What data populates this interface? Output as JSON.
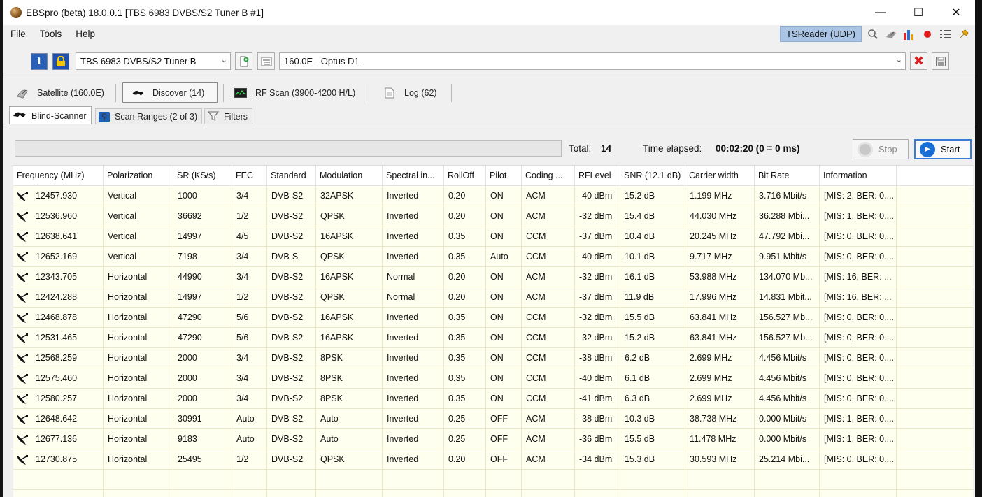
{
  "window": {
    "title": "EBSpro (beta) 18.0.0.1 [TBS 6983 DVBS/S2 Tuner B #1]",
    "controls": {
      "minimize": "—",
      "maximize": "☐",
      "close": "✕"
    }
  },
  "menu": {
    "items": [
      "File",
      "Tools",
      "Help"
    ],
    "tsreader": "TSReader (UDP)",
    "toolbar_icons": [
      "search-icon",
      "satellite-dish-icon",
      "bar-chart-icon",
      "record-icon",
      "list-icon",
      "pin-icon"
    ]
  },
  "device": {
    "tuner": "TBS 6983 DVBS/S2 Tuner B",
    "satellite": "160.0E - Optus D1"
  },
  "tabs": [
    {
      "label": "Satellite (160.0E)",
      "icon": "satellite-icon"
    },
    {
      "label": "Discover (14)",
      "icon": "discover-icon"
    },
    {
      "label": "RF Scan (3900-4200 H/L)",
      "icon": "spectrum-icon"
    },
    {
      "label": "Log (62)",
      "icon": "log-icon"
    }
  ],
  "subtabs": [
    {
      "label": "Blind-Scanner"
    },
    {
      "label": "Scan Ranges (2 of 3)"
    },
    {
      "label": "Filters"
    }
  ],
  "scanner": {
    "progress": 0,
    "total_label": "Total:",
    "total": "14",
    "elapsed_label": "Time elapsed:",
    "elapsed": "00:02:20 (0 = 0 ms)",
    "stop": "Stop",
    "start": "Start"
  },
  "table": {
    "headers": [
      "Frequency (MHz)",
      "Polarization",
      "SR (KS/s)",
      "FEC",
      "Standard",
      "Modulation",
      "Spectral in...",
      "RollOff",
      "Pilot",
      "Coding ...",
      "RFLevel",
      "SNR (12.1 dB)",
      "Carrier width",
      "Bit Rate",
      "Information"
    ],
    "rows": [
      [
        "12457.930",
        "Vertical",
        "1000",
        "3/4",
        "DVB-S2",
        "32APSK",
        "Inverted",
        "0.20",
        "ON",
        "ACM",
        "-40 dBm",
        "15.2 dB",
        "1.199 MHz",
        "3.716 Mbit/s",
        "[MIS: 2, BER: 0...."
      ],
      [
        "12536.960",
        "Vertical",
        "36692",
        "1/2",
        "DVB-S2",
        "QPSK",
        "Inverted",
        "0.20",
        "ON",
        "ACM",
        "-32 dBm",
        "15.4 dB",
        "44.030 MHz",
        "36.288 Mbi...",
        "[MIS: 1, BER: 0...."
      ],
      [
        "12638.641",
        "Vertical",
        "14997",
        "4/5",
        "DVB-S2",
        "16APSK",
        "Inverted",
        "0.35",
        "ON",
        "CCM",
        "-37 dBm",
        "10.4 dB",
        "20.245 MHz",
        "47.792 Mbi...",
        "[MIS: 0, BER: 0...."
      ],
      [
        "12652.169",
        "Vertical",
        "7198",
        "3/4",
        "DVB-S",
        "QPSK",
        "Inverted",
        "0.35",
        "Auto",
        "CCM",
        "-40 dBm",
        "10.1 dB",
        "9.717 MHz",
        "9.951 Mbit/s",
        "[MIS: 0, BER: 0...."
      ],
      [
        "12343.705",
        "Horizontal",
        "44990",
        "3/4",
        "DVB-S2",
        "16APSK",
        "Normal",
        "0.20",
        "ON",
        "ACM",
        "-32 dBm",
        "16.1 dB",
        "53.988 MHz",
        "134.070 Mb...",
        "[MIS: 16, BER: ..."
      ],
      [
        "12424.288",
        "Horizontal",
        "14997",
        "1/2",
        "DVB-S2",
        "QPSK",
        "Normal",
        "0.20",
        "ON",
        "ACM",
        "-37 dBm",
        "11.9 dB",
        "17.996 MHz",
        "14.831 Mbit...",
        "[MIS: 16, BER: ..."
      ],
      [
        "12468.878",
        "Horizontal",
        "47290",
        "5/6",
        "DVB-S2",
        "16APSK",
        "Inverted",
        "0.35",
        "ON",
        "CCM",
        "-32 dBm",
        "15.5 dB",
        "63.841 MHz",
        "156.527 Mb...",
        "[MIS: 0, BER: 0...."
      ],
      [
        "12531.465",
        "Horizontal",
        "47290",
        "5/6",
        "DVB-S2",
        "16APSK",
        "Inverted",
        "0.35",
        "ON",
        "CCM",
        "-32 dBm",
        "15.2 dB",
        "63.841 MHz",
        "156.527 Mb...",
        "[MIS: 0, BER: 0...."
      ],
      [
        "12568.259",
        "Horizontal",
        "2000",
        "3/4",
        "DVB-S2",
        "8PSK",
        "Inverted",
        "0.35",
        "ON",
        "CCM",
        "-38 dBm",
        "6.2 dB",
        "2.699 MHz",
        "4.456 Mbit/s",
        "[MIS: 0, BER: 0...."
      ],
      [
        "12575.460",
        "Horizontal",
        "2000",
        "3/4",
        "DVB-S2",
        "8PSK",
        "Inverted",
        "0.35",
        "ON",
        "CCM",
        "-40 dBm",
        "6.1 dB",
        "2.699 MHz",
        "4.456 Mbit/s",
        "[MIS: 0, BER: 0...."
      ],
      [
        "12580.257",
        "Horizontal",
        "2000",
        "3/4",
        "DVB-S2",
        "8PSK",
        "Inverted",
        "0.35",
        "ON",
        "CCM",
        "-41 dBm",
        "6.3 dB",
        "2.699 MHz",
        "4.456 Mbit/s",
        "[MIS: 0, BER: 0...."
      ],
      [
        "12648.642",
        "Horizontal",
        "30991",
        "Auto",
        "DVB-S2",
        "Auto",
        "Inverted",
        "0.25",
        "OFF",
        "ACM",
        "-38 dBm",
        "10.3 dB",
        "38.738 MHz",
        "0.000 Mbit/s",
        "[MIS: 1, BER: 0...."
      ],
      [
        "12677.136",
        "Horizontal",
        "9183",
        "Auto",
        "DVB-S2",
        "Auto",
        "Inverted",
        "0.25",
        "OFF",
        "ACM",
        "-36 dBm",
        "15.5 dB",
        "11.478 MHz",
        "0.000 Mbit/s",
        "[MIS: 1, BER: 0...."
      ],
      [
        "12730.875",
        "Horizontal",
        "25495",
        "1/2",
        "DVB-S2",
        "QPSK",
        "Inverted",
        "0.20",
        "OFF",
        "ACM",
        "-34 dBm",
        "15.3 dB",
        "30.593 MHz",
        "25.214 Mbi...",
        "[MIS: 0, BER: 0...."
      ]
    ]
  },
  "colors": {
    "row_bg": "#fffff0",
    "accent": "#1a6fd6",
    "tsreader_bg": "#a9c4e4"
  }
}
